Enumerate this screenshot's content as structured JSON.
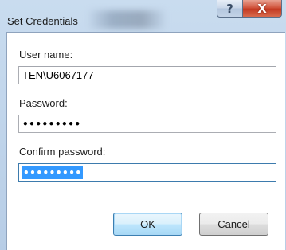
{
  "window": {
    "title": "Set Credentials"
  },
  "titlebar": {
    "help_icon": "help-icon",
    "close_icon": "close-icon",
    "help_glyph": "?",
    "close_glyph": "X"
  },
  "form": {
    "username_label": "User name:",
    "username_value": "TEN\\U6067177",
    "password_label": "Password:",
    "password_value": "•••••••••",
    "confirm_label": "Confirm password:",
    "confirm_value": "•••••••••"
  },
  "buttons": {
    "ok_label": "OK",
    "cancel_label": "Cancel"
  },
  "colors": {
    "selection": "#3399ff",
    "close_button": "#c33a22",
    "default_button_border": "#3c7fb1"
  }
}
